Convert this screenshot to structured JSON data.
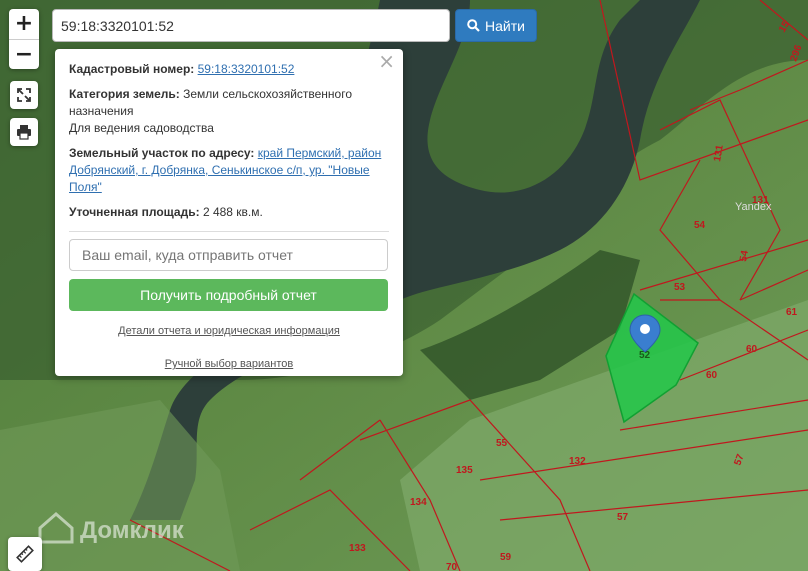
{
  "search": {
    "value": "59:18:3320101:52",
    "button_label": "Найти"
  },
  "zoom": {
    "in_label": "+",
    "out_label": "−"
  },
  "popup": {
    "cadastral_label": "Кадастровый номер:",
    "cadastral_value": "59:18:3320101:52",
    "category_label": "Категория земель:",
    "category_value": "Земли сельскохозяйственного назначения",
    "usage": "Для ведения садоводства",
    "address_label": "Земельный участок по адресу:",
    "address_value": "край Пермский, район Добрянский, г. Добрянка, Сенькинское с/п, ур. \"Новые Поля\"",
    "area_label": "Уточненная площадь:",
    "area_value": "2 488 кв.м.",
    "email_placeholder": "Ваш email, куда отправить отчет",
    "report_button": "Получить подробный отчет",
    "details_link": "Детали отчета и юридическая информация",
    "manual_link": "Ручной выбор вариантов"
  },
  "map": {
    "watermark": "Домклик",
    "yandex": "Yandex",
    "selected_parcel": "52",
    "parcel_labels": [
      "15",
      "296",
      "131",
      "131",
      "54",
      "54",
      "53",
      "61",
      "60",
      "60",
      "55",
      "135",
      "132",
      "57",
      "134",
      "57",
      "133",
      "59",
      "70"
    ],
    "colors": {
      "boundary": "#c0181e",
      "selected_fill": "#22c84a",
      "marker": "#3a7ecf",
      "button": "#2f7bbf",
      "report_button": "#5cb85c"
    }
  }
}
